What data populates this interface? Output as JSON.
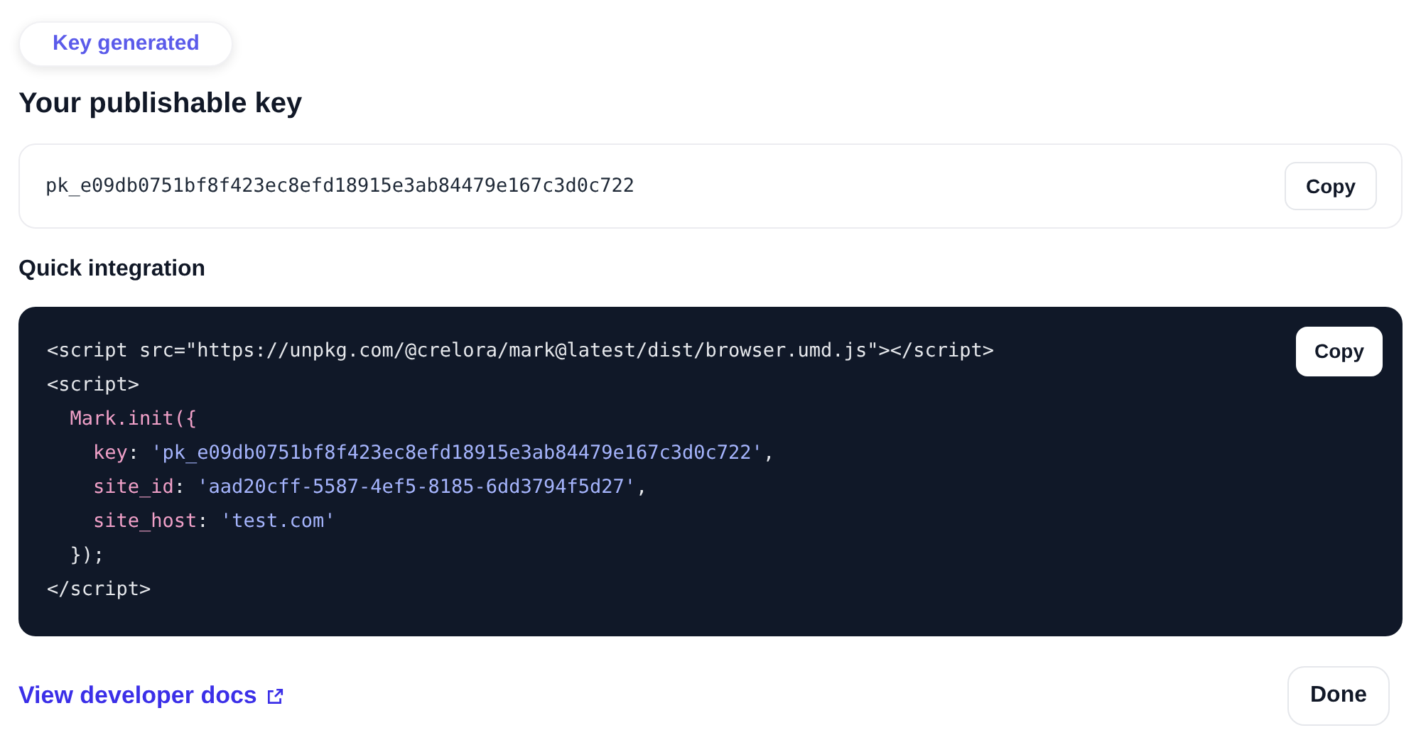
{
  "badge": "Key generated",
  "title": "Your publishable key",
  "key_field": {
    "value": "pk_e09db0751bf8f423ec8efd18915e3ab84479e167c3d0c722",
    "button": "Copy"
  },
  "integration": {
    "heading": "Quick integration",
    "button": "Copy",
    "lines": [
      [
        {
          "kind": "plain",
          "text": "<script src=\"https://unpkg.com/@crelora/mark@latest/dist/browser.umd.js\"></script>"
        }
      ],
      [
        {
          "kind": "plain",
          "text": "<script>"
        }
      ],
      [
        {
          "kind": "keyword",
          "text": "  Mark.init({"
        }
      ],
      [
        {
          "kind": "keyword",
          "text": "    key"
        },
        {
          "kind": "plain",
          "text": ": "
        },
        {
          "kind": "string",
          "text": "'pk_e09db0751bf8f423ec8efd18915e3ab84479e167c3d0c722'"
        },
        {
          "kind": "plain",
          "text": ","
        }
      ],
      [
        {
          "kind": "keyword",
          "text": "    site_id"
        },
        {
          "kind": "plain",
          "text": ": "
        },
        {
          "kind": "string",
          "text": "'aad20cff-5587-4ef5-8185-6dd3794f5d27'"
        },
        {
          "kind": "plain",
          "text": ","
        }
      ],
      [
        {
          "kind": "keyword",
          "text": "    site_host"
        },
        {
          "kind": "plain",
          "text": ": "
        },
        {
          "kind": "string",
          "text": "'test.com'"
        }
      ],
      [
        {
          "kind": "plain",
          "text": "  });"
        }
      ],
      [
        {
          "kind": "plain",
          "text": "</script>"
        }
      ]
    ]
  },
  "docs_link": "View developer docs",
  "done_button": "Done"
}
